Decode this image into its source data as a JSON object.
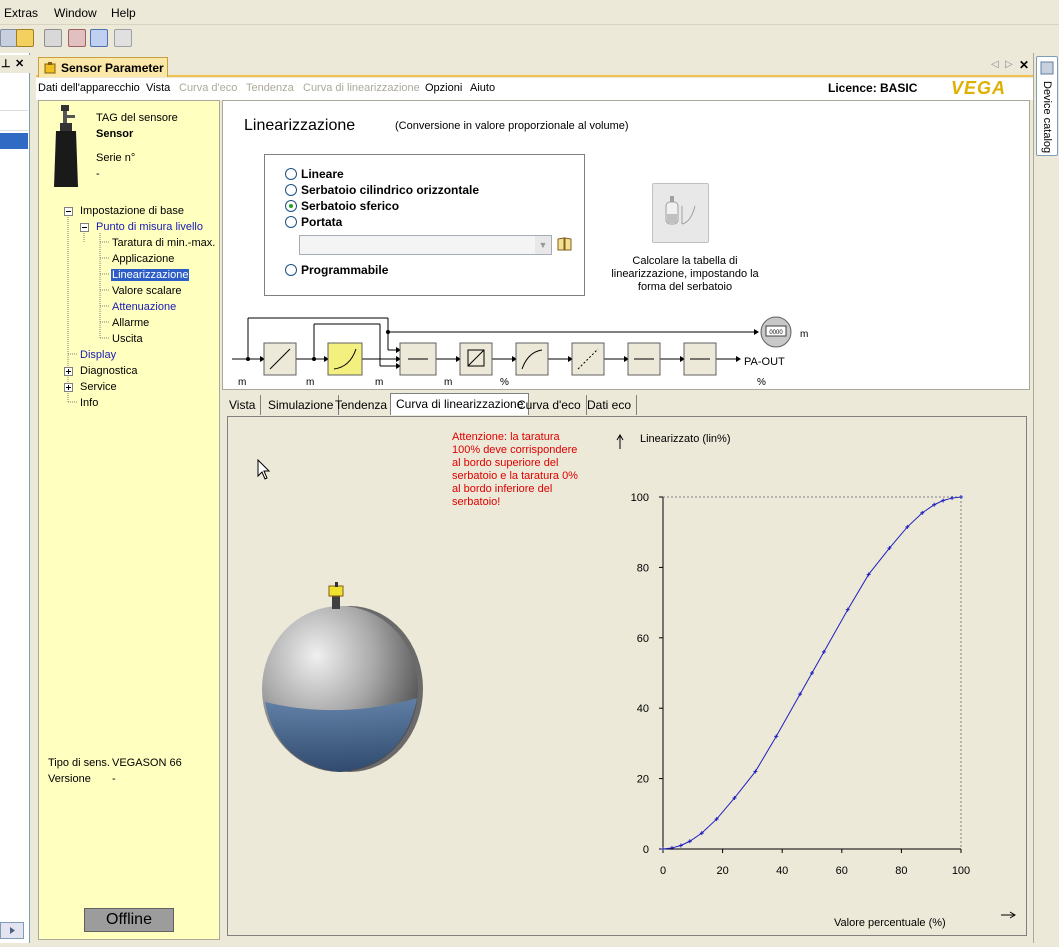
{
  "menubar": {
    "items": [
      "Extras",
      "Window",
      "Help"
    ]
  },
  "pin_glyphs": {
    "pin": "⊥",
    "close": "✕"
  },
  "doc_tab": {
    "label": "Sensor Parameter",
    "close": "✕"
  },
  "right_panel": {
    "label": "Device catalog"
  },
  "app_menu": {
    "items": [
      {
        "label": "Dati dell'apparecchio",
        "enabled": true
      },
      {
        "label": "Vista",
        "enabled": true
      },
      {
        "label": "Curva d'eco",
        "enabled": false
      },
      {
        "label": "Tendenza",
        "enabled": false
      },
      {
        "label": "Curva di linearizzazione",
        "enabled": false
      },
      {
        "label": "Opzioni",
        "enabled": true
      },
      {
        "label": "Aiuto",
        "enabled": true
      }
    ],
    "licence": "Licence: BASIC",
    "brand": "VEGA"
  },
  "device": {
    "tag_label": "TAG del sensore",
    "tag_value": "Sensor",
    "serial_label": "Serie n°",
    "serial_value": "-",
    "type_label": "Tipo di sens.",
    "type_value": "VEGASON 66",
    "version_label": "Versione",
    "version_value": "-",
    "status": "Offline"
  },
  "tree": {
    "root": "Impostazione di base",
    "group": "Punto di misura livello",
    "children": [
      "Taratura di min.-max.",
      "Applicazione",
      "Linearizzazione",
      "Valore scalare",
      "Attenuazione",
      "Allarme",
      "Uscita"
    ],
    "display": "Display",
    "diagnostica": "Diagnostica",
    "service": "Service",
    "info": "Info"
  },
  "linearization": {
    "title": "Linearizzazione",
    "subtitle": "(Conversione in valore proporzionale al volume)",
    "options": [
      "Lineare",
      "Serbatoio cilindrico orizzontale",
      "Serbatoio sferico",
      "Portata",
      "Programmabile"
    ],
    "selected": "Serbatoio sferico",
    "calc_text": "Calcolare la tabella di linearizzazione, impostando la forma del serbatoio"
  },
  "block_diagram": {
    "units": [
      "m",
      "m",
      "m",
      "m",
      "%",
      "%"
    ],
    "output_label": "PA-OUT",
    "top_unit": "m",
    "display_text": "0000"
  },
  "subtabs": [
    "Vista",
    "Simulazione",
    "Tendenza",
    "Curva di linearizzazione",
    "Curva d'eco",
    "Dati eco"
  ],
  "active_subtab": "Curva di linearizzazione",
  "warning": "Attenzione: la taratura 100% deve corrispondere al bordo superiore del serbatoio e la taratura 0% al bordo inferiore del serbatoio!",
  "chart_data": {
    "type": "line",
    "title": "",
    "xlabel": "Valore percentuale (%)",
    "ylabel": "Linearizzato (lin%)",
    "xlim": [
      0,
      100
    ],
    "ylim": [
      0,
      100
    ],
    "xticks": [
      0,
      20,
      40,
      60,
      80,
      100
    ],
    "yticks": [
      0,
      20,
      40,
      60,
      80,
      100
    ],
    "grid": false,
    "series": [
      {
        "color": "#2020c0",
        "x": [
          0,
          3,
          6,
          9,
          13,
          18,
          24,
          31,
          38,
          46,
          50,
          54,
          62,
          69,
          76,
          82,
          87,
          91,
          94,
          97,
          100
        ],
        "y": [
          0,
          0.3,
          1.0,
          2.2,
          4.5,
          8.5,
          14.5,
          22,
          32,
          44,
          50,
          56,
          68,
          78,
          85.5,
          91.5,
          95.5,
          97.8,
          99,
          99.7,
          100
        ]
      }
    ]
  }
}
